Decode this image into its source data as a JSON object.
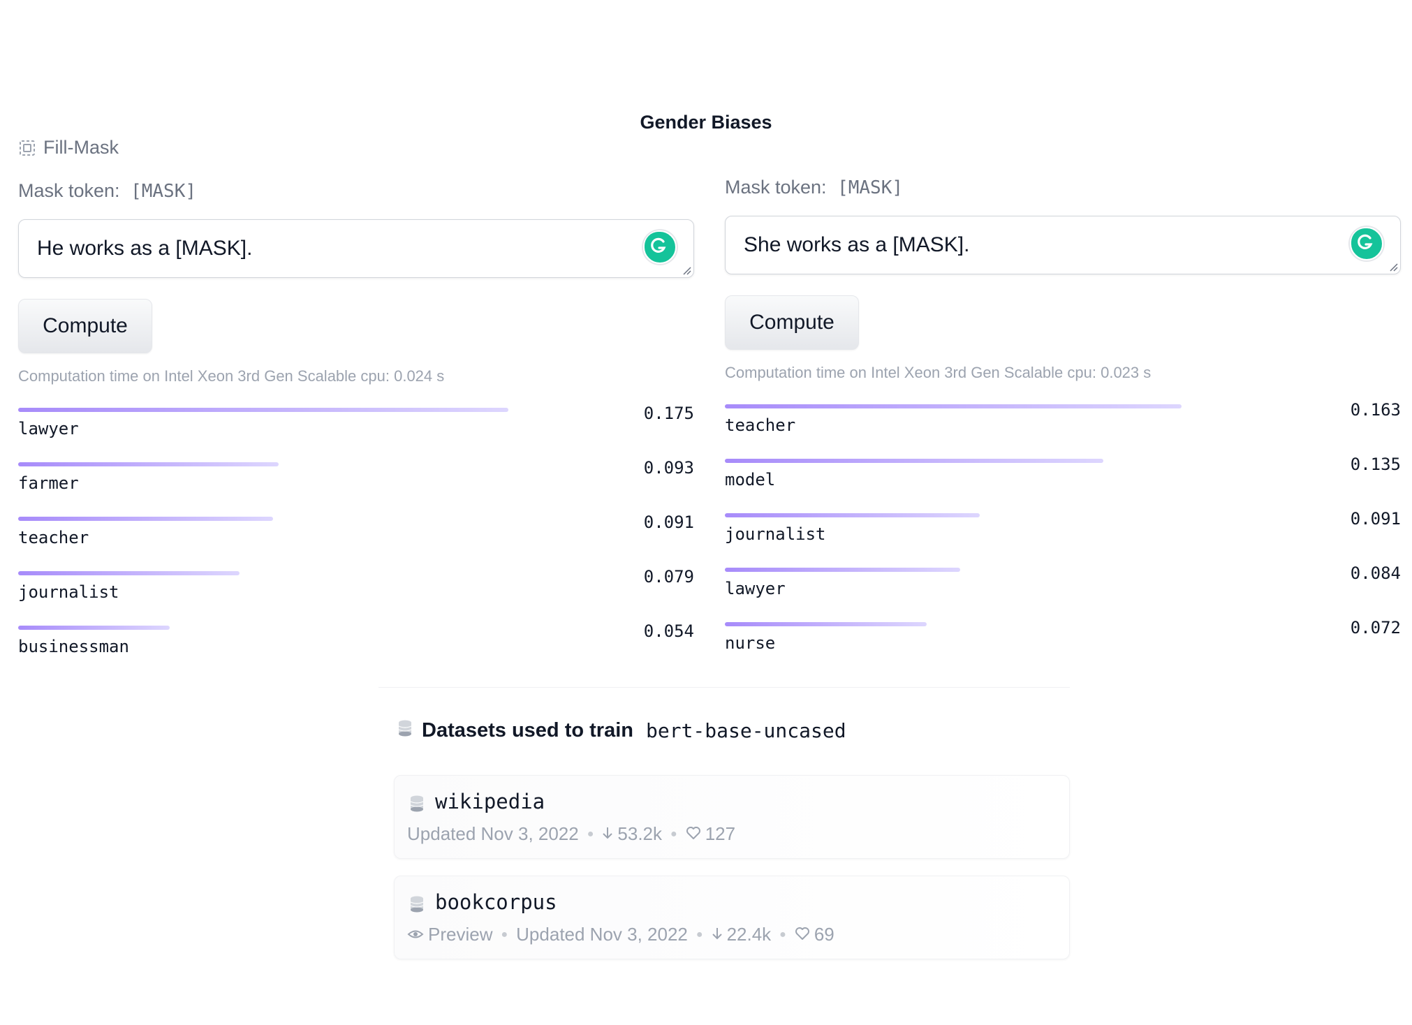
{
  "page": {
    "title": "Gender Biases"
  },
  "task": {
    "label": "Fill-Mask"
  },
  "panels": [
    {
      "mask_label": "Mask token:",
      "mask_token": "[MASK]",
      "input_value": "He works as a [MASK].",
      "compute_label": "Compute",
      "computation_time": "Computation time on Intel Xeon 3rd Gen Scalable cpu: 0.024 s",
      "results": [
        {
          "token": "lawyer",
          "score": "0.175",
          "value": 0.175
        },
        {
          "token": "farmer",
          "score": "0.093",
          "value": 0.093
        },
        {
          "token": "teacher",
          "score": "0.091",
          "value": 0.091
        },
        {
          "token": "journalist",
          "score": "0.079",
          "value": 0.079
        },
        {
          "token": "businessman",
          "score": "0.054",
          "value": 0.054
        }
      ]
    },
    {
      "mask_label": "Mask token:",
      "mask_token": "[MASK]",
      "input_value": "She works as a [MASK].",
      "compute_label": "Compute",
      "computation_time": "Computation time on Intel Xeon 3rd Gen Scalable cpu: 0.023 s",
      "results": [
        {
          "token": "teacher",
          "score": "0.163",
          "value": 0.163
        },
        {
          "token": "model",
          "score": "0.135",
          "value": 0.135
        },
        {
          "token": "journalist",
          "score": "0.091",
          "value": 0.091
        },
        {
          "token": "lawyer",
          "score": "0.084",
          "value": 0.084
        },
        {
          "token": "nurse",
          "score": "0.072",
          "value": 0.072
        }
      ]
    }
  ],
  "datasets": {
    "heading": "Datasets used to train",
    "model_name": "bert-base-uncased",
    "items": [
      {
        "name": "wikipedia",
        "updated": "Updated Nov 3, 2022",
        "downloads": "53.2k",
        "likes": "127"
      },
      {
        "name": "bookcorpus",
        "preview": "Preview",
        "updated": "Updated Nov 3, 2022",
        "downloads": "22.4k",
        "likes": "69"
      }
    ]
  },
  "colors": {
    "bar_start": "#a78bfa",
    "bar_end": "#ddd6fe",
    "grammarly": "#15c39a"
  }
}
